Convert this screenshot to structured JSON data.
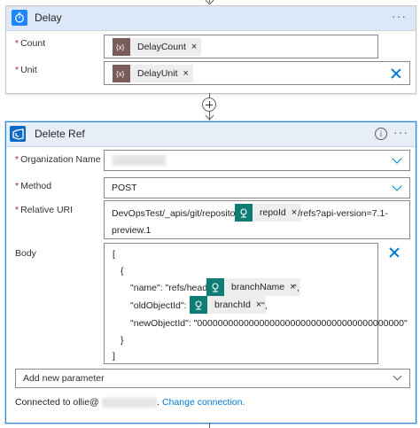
{
  "colors": {
    "accent": "#0078d4",
    "delay_header": "#dce8f7",
    "ref_header": "#e7eef7",
    "variable_token": "#7a5c58",
    "devops_token": "#0f7d74",
    "required_asterisk": "#a4262c"
  },
  "delay": {
    "title": "Delay",
    "icon": "timer-icon",
    "count": {
      "label": "Count",
      "required": "*",
      "token": "DelayCount"
    },
    "unit": {
      "label": "Unit",
      "required": "*",
      "token": "DelayUnit"
    }
  },
  "ref": {
    "title": "Delete Ref",
    "icon": "azure-devops-icon",
    "organization": {
      "label": "Organization Name",
      "required": "*"
    },
    "method": {
      "label": "Method",
      "required": "*",
      "value": "POST"
    },
    "uri": {
      "label": "Relative URI",
      "required": "*",
      "prefix": "DevOpsTest/_apis/git/repositories/",
      "token": "repoId",
      "suffix": "/refs?api-version=7.1-",
      "line2": "preview.1"
    },
    "body": {
      "label": "Body",
      "open_bracket": "[",
      "open_brace": "{",
      "name_key": "\"name\": \"refs/heads/",
      "name_token": "branchName",
      "name_end": "\",",
      "old_key": "\"oldObjectId\": \"",
      "old_token": "branchId",
      "old_end": "\",",
      "new_line": "\"newObjectId\": \"0000000000000000000000000000000000000000\"",
      "close_brace": "}",
      "close_bracket": "]"
    },
    "add_param": {
      "placeholder": "Add new parameter"
    },
    "connection": {
      "prefix": "Connected to ollie@",
      "suffix": ".",
      "change_label": "Change connection."
    }
  },
  "token_remove": "×",
  "more_label": "···",
  "info_label": "i"
}
